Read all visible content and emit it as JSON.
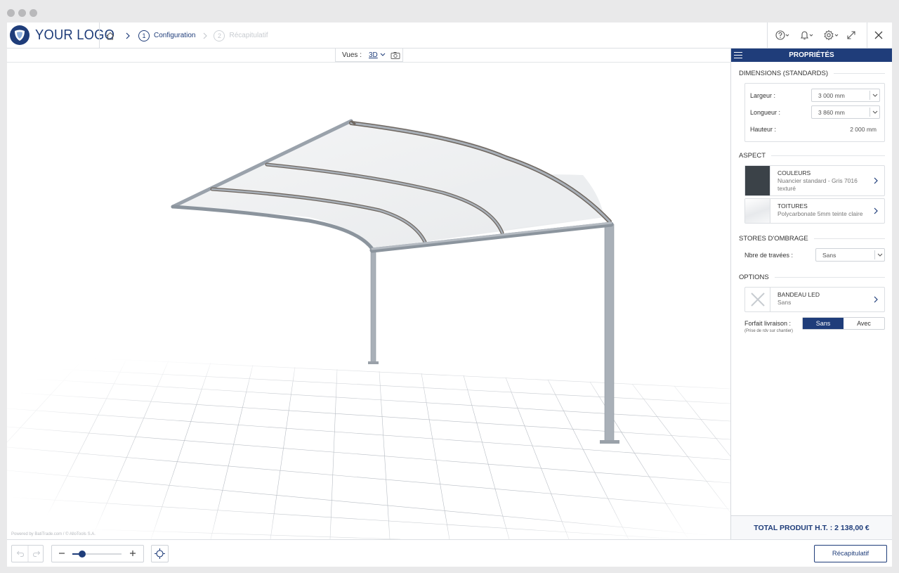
{
  "logo": {
    "text": "YOUR LOGO"
  },
  "breadcrumb": {
    "steps": [
      {
        "number": "1",
        "label": "Configuration",
        "active": true
      },
      {
        "number": "2",
        "label": "Récapitulatif",
        "active": false
      }
    ]
  },
  "toolbar": {
    "icons": [
      "help-icon",
      "bell-icon",
      "gear-icon",
      "expand-icon",
      "close-icon"
    ]
  },
  "viewer": {
    "views_label": "Vues :",
    "view_mode": "3D",
    "powered_by": "Powered by BatiTrade.com / © AlloTools S.A."
  },
  "panel": {
    "title": "PROPRIÉTÉS",
    "dimensions": {
      "title": "DIMENSIONS (STANDARDS)",
      "width_label": "Largeur :",
      "width_value": "3 000 mm",
      "length_label": "Longueur :",
      "length_value": "3 860 mm",
      "height_label": "Hauteur :",
      "height_value": "2 000 mm"
    },
    "aspect": {
      "title": "ASPECT",
      "colors": {
        "title": "COULEURS",
        "subtitle": "Nuancier standard - Gris 7016 texturé",
        "swatch": "#3b4248"
      },
      "roofs": {
        "title": "TOITURES",
        "subtitle": "Polycarbonate 5mm teinte claire"
      }
    },
    "shades": {
      "title": "STORES D'OMBRAGE",
      "bays_label": "Nbre de travées :",
      "bays_value": "Sans"
    },
    "options": {
      "title": "OPTIONS",
      "led": {
        "title": "BANDEAU LED",
        "subtitle": "Sans"
      },
      "delivery_label": "Forfait livraison :",
      "delivery_note": "(Prise de rdv sur chantier)",
      "delivery_choices": [
        "Sans",
        "Avec"
      ],
      "delivery_selected": "Sans"
    },
    "total": "TOTAL PRODUIT H.T. : 2 138,00 €"
  },
  "bottom": {
    "zoom_level": 0.2,
    "recap_button": "Récapitulatif"
  },
  "colors": {
    "accent": "#1f3d7a",
    "border": "#dcdfe3"
  }
}
